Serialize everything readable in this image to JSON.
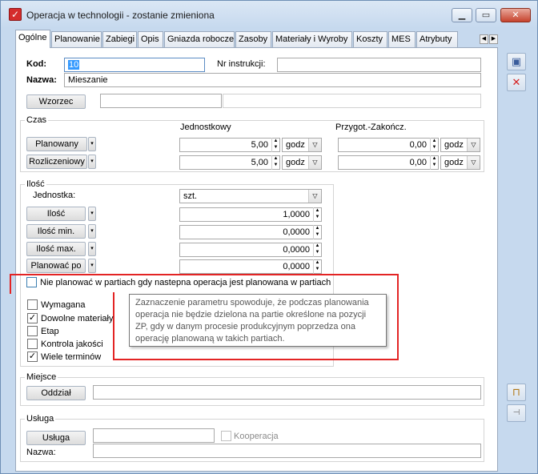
{
  "window": {
    "title": "Operacja w technologii - zostanie zmieniona"
  },
  "tabs": [
    "Ogólne",
    "Planowanie",
    "Zabiegi",
    "Opis",
    "Gniazda robocze",
    "Zasoby",
    "Materiały i Wyroby",
    "Koszty",
    "MES",
    "Atrybuty"
  ],
  "general": {
    "kod_label": "Kod:",
    "kod_value": "10",
    "nr_instr_label": "Nr instrukcji:",
    "nr_instr_value": "",
    "nazwa_label": "Nazwa:",
    "nazwa_value": "Mieszanie",
    "wzorzec_button": "Wzorzec",
    "wzorzec_value": ""
  },
  "czas": {
    "group_label": "Czas",
    "col1": "Jednostkowy",
    "col2": "Przygot.-Zakończ.",
    "rows": [
      {
        "button": "Planowany",
        "val1": "5,00",
        "unit1": "godz",
        "val2": "0,00",
        "unit2": "godz"
      },
      {
        "button": "Rozliczeniowy",
        "val1": "5,00",
        "unit1": "godz",
        "val2": "0,00",
        "unit2": "godz"
      }
    ]
  },
  "ilosc": {
    "group_label": "Ilość",
    "jednostka_label": "Jednostka:",
    "jednostka_value": "szt.",
    "rows": [
      {
        "button": "Ilość",
        "value": "1,0000"
      },
      {
        "button": "Ilość min.",
        "value": "0,0000"
      },
      {
        "button": "Ilość max.",
        "value": "0,0000"
      },
      {
        "button": "Planować po",
        "value": "0,0000"
      }
    ]
  },
  "partie_checkbox": {
    "label": "Nie planować w partiach gdy nastepna operacja jest planowana w partiach",
    "checked": false
  },
  "tooltip": "Zaznaczenie parametru spowoduje, że podczas planowania operacja nie będzie dzielona na partie określone na pozycji ZP, gdy w danym procesie produkcyjnym poprzedza ona operację planowaną w takich partiach.",
  "options": [
    {
      "label": "Wymagana",
      "checked": false
    },
    {
      "label": "Dowolne materiały",
      "checked": true
    },
    {
      "label": "Etap",
      "checked": false
    },
    {
      "label": "Kontrola jakości",
      "checked": false
    },
    {
      "label": "Wiele terminów",
      "checked": true
    }
  ],
  "miejsce": {
    "group_label": "Miejsce",
    "oddzial_button": "Oddział",
    "oddzial_value": ""
  },
  "usluga": {
    "group_label": "Usługa",
    "usluga_button": "Usługa",
    "usluga_value": "",
    "kooperacja_label": "Kooperacja",
    "kooperacja_checked": false,
    "nazwa_label": "Nazwa:",
    "nazwa_value": ""
  },
  "colors": {
    "highlight_box": "#e32424",
    "window_frame": "#c6d9ee"
  }
}
